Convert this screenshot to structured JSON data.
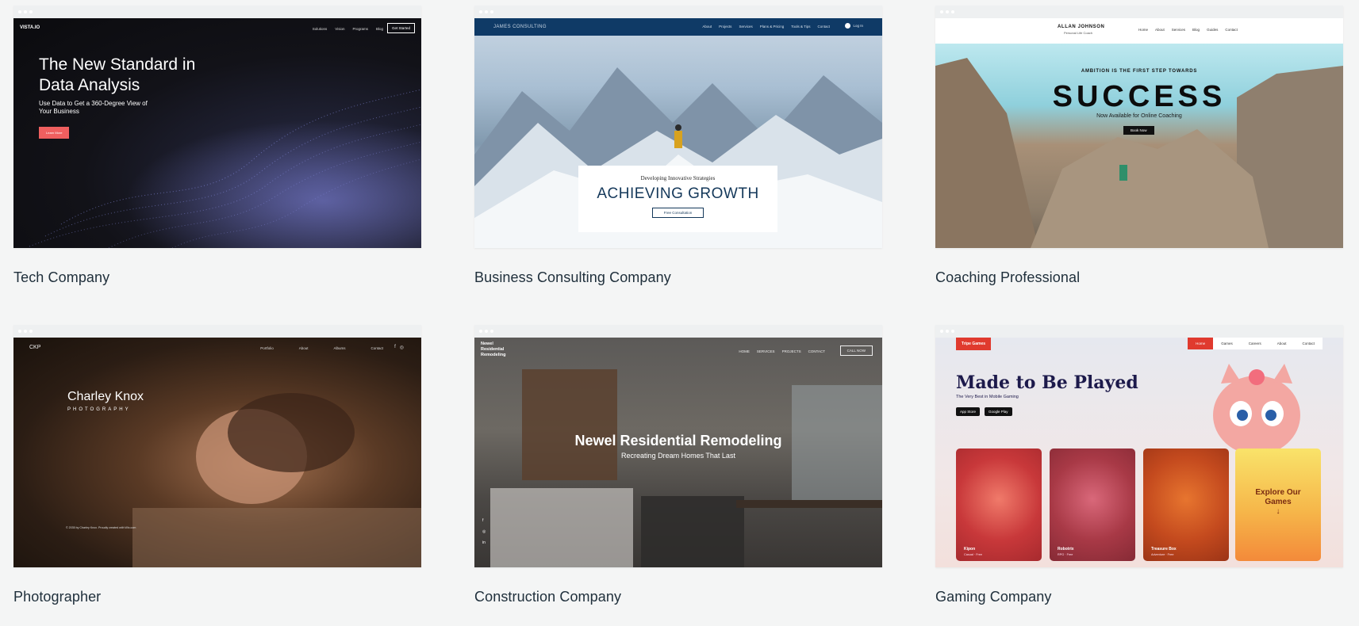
{
  "templates": [
    {
      "caption": "Tech Company",
      "preview": {
        "logo": "VISTA.IO",
        "nav": [
          "Solutions",
          "Vision",
          "Programs",
          "Blog"
        ],
        "cta": "Get Started",
        "headline": "The New Standard in Data Analysis",
        "subline": "Use Data to Get a 360-Degree View of Your Business",
        "button": "Learn More"
      }
    },
    {
      "caption": "Business Consulting Company",
      "preview": {
        "brand": "JAMES CONSULTING",
        "nav": [
          "About",
          "Projects",
          "Services",
          "Plans & Pricing",
          "Tools & Tips",
          "Contact"
        ],
        "login": "Log In",
        "kicker": "Developing Innovative Strategies",
        "headline": "ACHIEVING GROWTH",
        "button": "Free Consultation"
      }
    },
    {
      "caption": "Coaching Professional",
      "preview": {
        "name": "ALLAN JOHNSON",
        "role": "Personal Life Coach",
        "nav": [
          "Home",
          "About",
          "Services",
          "Blog",
          "Guides",
          "Contact"
        ],
        "kicker": "AMBITION IS THE FIRST STEP TOWARDS",
        "headline": "SUCCESS",
        "subline": "Now Available for Online Coaching",
        "button": "Book Now"
      }
    },
    {
      "caption": "Photographer",
      "preview": {
        "logo": "CKP",
        "nav": [
          "Portfolio",
          "About",
          "Albums",
          "Contact"
        ],
        "social": [
          "f",
          "◎"
        ],
        "name": "Charley Knox",
        "tagline": "PHOTOGRAPHY",
        "copyright": "© 2035 by Charley Knox. Proudly created with Wix.com"
      }
    },
    {
      "caption": "Construction Company",
      "preview": {
        "logo": "Newel Residential Remodeling",
        "nav": [
          "HOME",
          "SERVICES",
          "PROJECTS",
          "CONTACT"
        ],
        "cta": "CALL NOW",
        "headline": "Newel Residential Remodeling",
        "subline": "Recreating Dream Homes That Last",
        "social": [
          "f",
          "◎",
          "in"
        ]
      }
    },
    {
      "caption": "Gaming Company",
      "preview": {
        "logo": "Tripe Games",
        "nav": [
          "Home",
          "Games",
          "Careers",
          "About",
          "Contact"
        ],
        "headline": "Made to Be Played",
        "subline": "The Very Best in Mobile Gaming",
        "stores": [
          "App Store",
          "Google Play"
        ],
        "tiles": [
          {
            "title": "Kipon",
            "meta": "Casual · Free"
          },
          {
            "title": "Robotrix",
            "meta": "RPG · Free"
          },
          {
            "title": "Treasure Box",
            "meta": "Adventure · Free"
          }
        ],
        "explore": "Explore Our Games",
        "explore_arrow": "↓"
      }
    }
  ],
  "colors": {
    "page_bg": "#f4f5f5",
    "caption_text": "#20303c",
    "tech_button": "#ef5f5f",
    "biz_topbar": "#0f3a66",
    "game_accent": "#e03a2e"
  }
}
